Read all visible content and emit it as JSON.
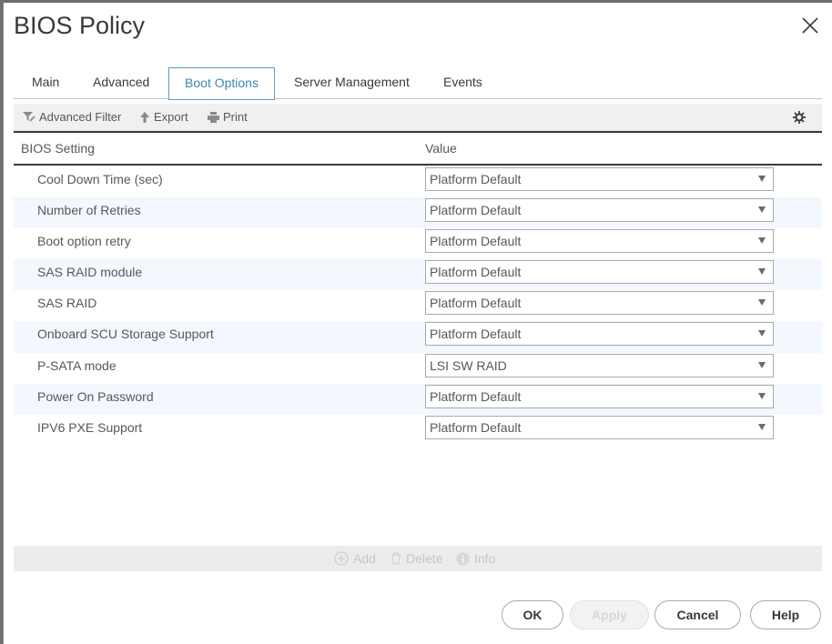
{
  "dialog": {
    "title": "BIOS Policy",
    "close_icon": "close-icon"
  },
  "tabs": [
    {
      "label": "Main",
      "active": false
    },
    {
      "label": "Advanced",
      "active": false
    },
    {
      "label": "Boot Options",
      "active": true
    },
    {
      "label": "Server Management",
      "active": false
    },
    {
      "label": "Events",
      "active": false
    }
  ],
  "toolbar": {
    "filter_label": "Advanced Filter",
    "filter_icon": "filter-icon",
    "export_label": "Export",
    "export_icon": "arrow-up-icon",
    "print_label": "Print",
    "print_icon": "printer-icon",
    "settings_icon": "gear-icon"
  },
  "table": {
    "columns": [
      "BIOS Setting",
      "Value"
    ],
    "rows": [
      {
        "setting": "Cool Down Time (sec)",
        "value": "Platform Default"
      },
      {
        "setting": "Number of Retries",
        "value": "Platform Default"
      },
      {
        "setting": "Boot option retry",
        "value": "Platform Default"
      },
      {
        "setting": "SAS RAID module",
        "value": "Platform Default"
      },
      {
        "setting": "SAS RAID",
        "value": "Platform Default"
      },
      {
        "setting": "Onboard SCU Storage Support",
        "value": "Platform Default"
      },
      {
        "setting": "P-SATA mode",
        "value": "LSI SW RAID"
      },
      {
        "setting": "Power On Password",
        "value": "Platform Default"
      },
      {
        "setting": "IPV6 PXE Support",
        "value": "Platform Default"
      }
    ]
  },
  "bottom_bar": {
    "add_label": "Add",
    "delete_label": "Delete",
    "info_label": "Info"
  },
  "buttons": {
    "ok": "OK",
    "apply": "Apply",
    "cancel": "Cancel",
    "help": "Help"
  },
  "colors": {
    "active_tab": "#3d86b5",
    "alt_row": "#f2f8fd",
    "toolbar_bg": "#f0f0f0"
  }
}
